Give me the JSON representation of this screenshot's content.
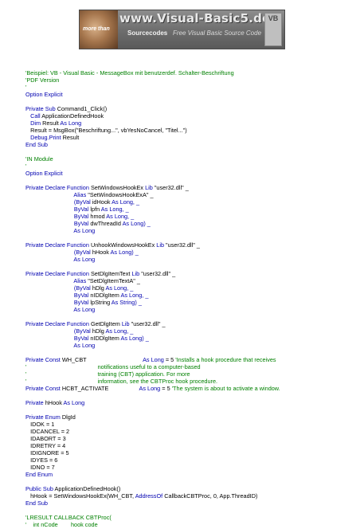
{
  "banner": {
    "site_name": "www.Visual-Basic5.de",
    "more_than": "more than",
    "sourcecodes": "Sourcecodes",
    "tagline": "Free Visual Basic Source Code",
    "badge": "VB"
  },
  "colors": {
    "keyword": "#0000b0",
    "comment": "#008000",
    "text": "#000000"
  },
  "code": [
    [
      {
        "t": "cm",
        "v": "'Beispiel: VB - Visual Basic - MessageBox mit benutzerdef. Schalter-Beschriftung"
      }
    ],
    [
      {
        "t": "cm",
        "v": "'PDF Version"
      }
    ],
    [
      {
        "t": "cm",
        "v": "'"
      }
    ],
    [
      {
        "t": "kw",
        "v": "Option Explicit"
      }
    ],
    [],
    [
      {
        "t": "kw",
        "v": "Private Sub "
      },
      {
        "t": "tx",
        "v": "Command1_Click()"
      }
    ],
    [
      {
        "t": "tx",
        "v": "   "
      },
      {
        "t": "kw",
        "v": "Call "
      },
      {
        "t": "tx",
        "v": "ApplicationDefinedHook"
      }
    ],
    [
      {
        "t": "tx",
        "v": "   "
      },
      {
        "t": "kw",
        "v": "Dim "
      },
      {
        "t": "tx",
        "v": "Result "
      },
      {
        "t": "kw",
        "v": "As Long"
      }
    ],
    [
      {
        "t": "tx",
        "v": "   Result = MsgBox(\"Beschriftung...\", vbYesNoCancel, \"Titel...\")"
      }
    ],
    [
      {
        "t": "tx",
        "v": "   "
      },
      {
        "t": "kw",
        "v": "Debug.Print "
      },
      {
        "t": "tx",
        "v": "Result"
      }
    ],
    [
      {
        "t": "kw",
        "v": "End Sub"
      }
    ],
    [],
    [
      {
        "t": "cm",
        "v": "'IN Module"
      }
    ],
    [
      {
        "t": "cm",
        "v": "'"
      }
    ],
    [
      {
        "t": "kw",
        "v": "Option Explicit"
      }
    ],
    [],
    [
      {
        "t": "kw",
        "v": "Private Declare Function "
      },
      {
        "t": "tx",
        "v": "SetWindowsHookEx "
      },
      {
        "t": "kw",
        "v": "Lib "
      },
      {
        "t": "tx",
        "v": "\"user32.dll\" _"
      }
    ],
    [
      {
        "t": "tx",
        "v": "                              "
      },
      {
        "t": "kw",
        "v": "Alias "
      },
      {
        "t": "tx",
        "v": "\"SetWindowsHookExA\" _"
      }
    ],
    [
      {
        "t": "tx",
        "v": "                              "
      },
      {
        "t": "kw",
        "v": "(ByVal "
      },
      {
        "t": "tx",
        "v": "idHook "
      },
      {
        "t": "kw",
        "v": "As Long, _"
      }
    ],
    [
      {
        "t": "tx",
        "v": "                              "
      },
      {
        "t": "kw",
        "v": "ByVal "
      },
      {
        "t": "tx",
        "v": "lpfn "
      },
      {
        "t": "kw",
        "v": "As Long, _"
      }
    ],
    [
      {
        "t": "tx",
        "v": "                              "
      },
      {
        "t": "kw",
        "v": "ByVal "
      },
      {
        "t": "tx",
        "v": "hmod "
      },
      {
        "t": "kw",
        "v": "As Long, _"
      }
    ],
    [
      {
        "t": "tx",
        "v": "                              "
      },
      {
        "t": "kw",
        "v": "ByVal "
      },
      {
        "t": "tx",
        "v": "dwThreadId "
      },
      {
        "t": "kw",
        "v": "As Long) _"
      }
    ],
    [
      {
        "t": "tx",
        "v": "                              "
      },
      {
        "t": "kw",
        "v": "As Long"
      }
    ],
    [],
    [
      {
        "t": "kw",
        "v": "Private Declare Function "
      },
      {
        "t": "tx",
        "v": "UnhookWindowsHookEx "
      },
      {
        "t": "kw",
        "v": "Lib "
      },
      {
        "t": "tx",
        "v": "\"user32.dll\" _"
      }
    ],
    [
      {
        "t": "tx",
        "v": "                              "
      },
      {
        "t": "kw",
        "v": "(ByVal "
      },
      {
        "t": "tx",
        "v": "hHook "
      },
      {
        "t": "kw",
        "v": "As Long) _"
      }
    ],
    [
      {
        "t": "tx",
        "v": "                              "
      },
      {
        "t": "kw",
        "v": "As Long"
      }
    ],
    [],
    [
      {
        "t": "kw",
        "v": "Private Declare Function "
      },
      {
        "t": "tx",
        "v": "SetDlgItemText "
      },
      {
        "t": "kw",
        "v": "Lib "
      },
      {
        "t": "tx",
        "v": "\"user32.dll\" _"
      }
    ],
    [
      {
        "t": "tx",
        "v": "                              "
      },
      {
        "t": "kw",
        "v": "Alias "
      },
      {
        "t": "tx",
        "v": "\"SetDlgItemTextA\" _"
      }
    ],
    [
      {
        "t": "tx",
        "v": "                              "
      },
      {
        "t": "kw",
        "v": "(ByVal "
      },
      {
        "t": "tx",
        "v": "hDlg "
      },
      {
        "t": "kw",
        "v": "As Long, _"
      }
    ],
    [
      {
        "t": "tx",
        "v": "                              "
      },
      {
        "t": "kw",
        "v": "ByVal "
      },
      {
        "t": "tx",
        "v": "nIDDlgItem "
      },
      {
        "t": "kw",
        "v": "As Long, _"
      }
    ],
    [
      {
        "t": "tx",
        "v": "                              "
      },
      {
        "t": "kw",
        "v": "ByVal "
      },
      {
        "t": "tx",
        "v": "lpString "
      },
      {
        "t": "kw",
        "v": "As String) _"
      }
    ],
    [
      {
        "t": "tx",
        "v": "                              "
      },
      {
        "t": "kw",
        "v": "As Long"
      }
    ],
    [],
    [
      {
        "t": "kw",
        "v": "Private Declare Function "
      },
      {
        "t": "tx",
        "v": "GetDlgItem "
      },
      {
        "t": "kw",
        "v": "Lib "
      },
      {
        "t": "tx",
        "v": "\"user32.dll\" _"
      }
    ],
    [
      {
        "t": "tx",
        "v": "                              "
      },
      {
        "t": "kw",
        "v": "(ByVal "
      },
      {
        "t": "tx",
        "v": "hDlg "
      },
      {
        "t": "kw",
        "v": "As Long, _"
      }
    ],
    [
      {
        "t": "tx",
        "v": "                              "
      },
      {
        "t": "kw",
        "v": "ByVal "
      },
      {
        "t": "tx",
        "v": "nIDDlgItem "
      },
      {
        "t": "kw",
        "v": "As Long) _"
      }
    ],
    [
      {
        "t": "tx",
        "v": "                              "
      },
      {
        "t": "kw",
        "v": "As Long"
      }
    ],
    [],
    [
      {
        "t": "kw",
        "v": "Private Const "
      },
      {
        "t": "tx",
        "v": "WH_CBT                                   "
      },
      {
        "t": "kw",
        "v": "As Long "
      },
      {
        "t": "tx",
        "v": "= 5 "
      },
      {
        "t": "cm",
        "v": "'Installs a hook procedure that receives"
      }
    ],
    [
      {
        "t": "cm",
        "v": "'                                            notifications useful to a computer-based"
      }
    ],
    [
      {
        "t": "cm",
        "v": "'                                            training (CBT) application. For more"
      }
    ],
    [
      {
        "t": "cm",
        "v": "'                                            information, see the CBTProc hook procedure."
      }
    ],
    [
      {
        "t": "kw",
        "v": "Private Const "
      },
      {
        "t": "tx",
        "v": "HCBT_ACTIVATE                   "
      },
      {
        "t": "kw",
        "v": "As Long "
      },
      {
        "t": "tx",
        "v": "= 5 "
      },
      {
        "t": "cm",
        "v": "'The system is about to activate a window."
      }
    ],
    [],
    [
      {
        "t": "kw",
        "v": "Private "
      },
      {
        "t": "tx",
        "v": "hHook "
      },
      {
        "t": "kw",
        "v": "As Long"
      }
    ],
    [],
    [
      {
        "t": "kw",
        "v": "Private Enum "
      },
      {
        "t": "tx",
        "v": "DlgId"
      }
    ],
    [
      {
        "t": "tx",
        "v": "   IDOK = 1"
      }
    ],
    [
      {
        "t": "tx",
        "v": "   IDCANCEL = 2"
      }
    ],
    [
      {
        "t": "tx",
        "v": "   IDABORT = 3"
      }
    ],
    [
      {
        "t": "tx",
        "v": "   IDRETRY = 4"
      }
    ],
    [
      {
        "t": "tx",
        "v": "   IDIGNORE = 5"
      }
    ],
    [
      {
        "t": "tx",
        "v": "   IDYES = 6"
      }
    ],
    [
      {
        "t": "tx",
        "v": "   IDNO = 7"
      }
    ],
    [
      {
        "t": "kw",
        "v": "End Enum"
      }
    ],
    [],
    [
      {
        "t": "kw",
        "v": "Public Sub "
      },
      {
        "t": "tx",
        "v": "ApplicationDefinedHook()"
      }
    ],
    [
      {
        "t": "tx",
        "v": "   hHook = SetWindowsHookEx(WH_CBT, "
      },
      {
        "t": "kw",
        "v": "AddressOf "
      },
      {
        "t": "tx",
        "v": "CallbackCBTProc, 0, App.ThreadID)"
      }
    ],
    [
      {
        "t": "kw",
        "v": "End Sub"
      }
    ],
    [],
    [
      {
        "t": "cm",
        "v": "'LRESULT CALLBACK CBTProc("
      }
    ],
    [
      {
        "t": "cm",
        "v": "'    int nCode        hook code"
      }
    ]
  ]
}
